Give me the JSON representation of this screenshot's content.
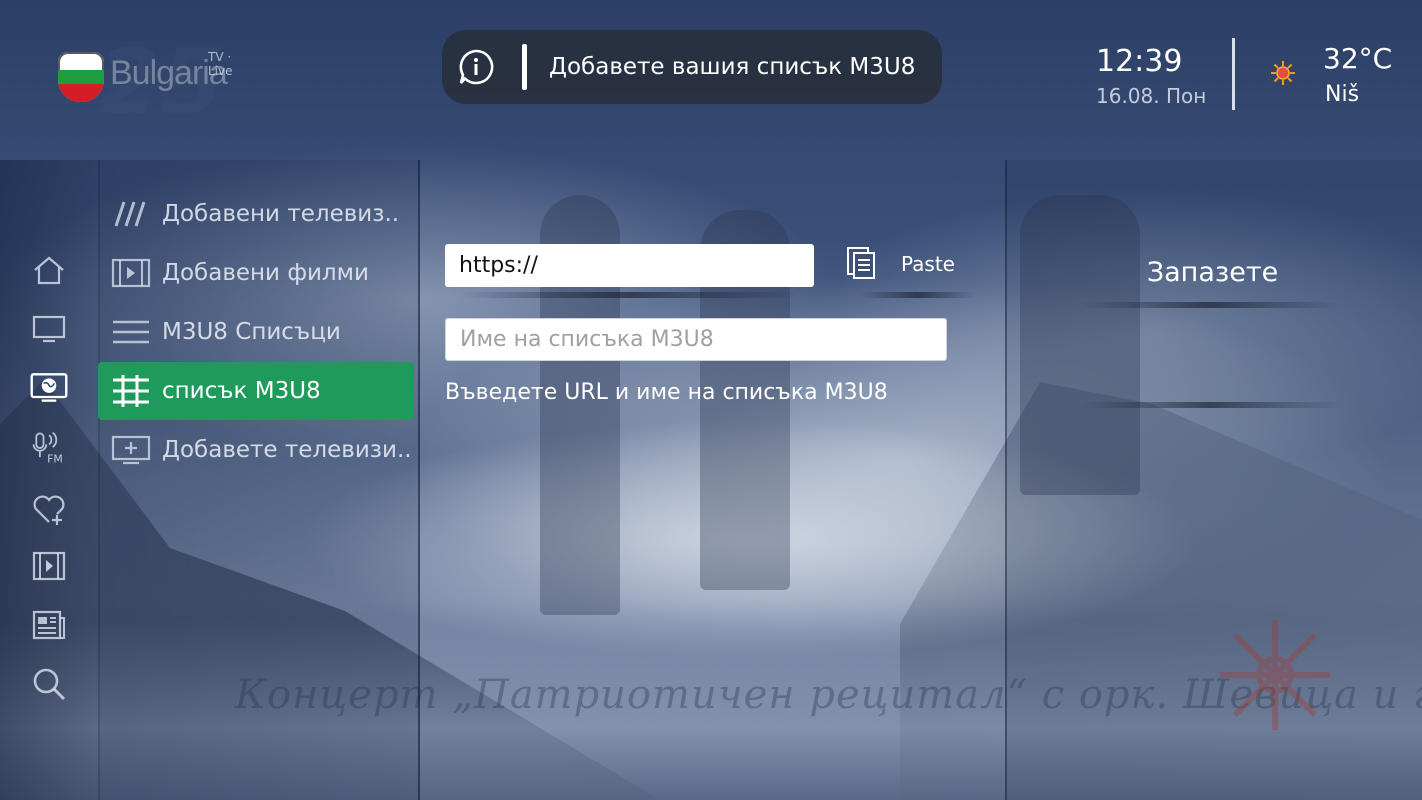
{
  "header": {
    "logo": {
      "brand": "Bulgaria",
      "superscript": "TV · Live"
    },
    "message": {
      "icon": "info-chat-icon",
      "text": "Добавете вашия списък M3U8"
    },
    "clock": {
      "time": "12:39",
      "date": "16.08. Пон"
    },
    "weather": {
      "icon": "sun-icon",
      "temperature": "32°C",
      "city": "Niš"
    }
  },
  "rail": {
    "items": [
      {
        "name": "home-icon"
      },
      {
        "name": "tv-icon"
      },
      {
        "name": "globe-tv-icon"
      },
      {
        "name": "radio-fm-icon",
        "label": "FM"
      },
      {
        "name": "favorites-add-icon"
      },
      {
        "name": "movies-icon"
      },
      {
        "name": "news-icon"
      },
      {
        "name": "search-icon"
      }
    ]
  },
  "menu": {
    "items": [
      {
        "icon": "slashes-icon",
        "label": "Добавени телевиз.."
      },
      {
        "icon": "film-icon",
        "label": "Добавени филми"
      },
      {
        "icon": "list-lines-icon",
        "label": "M3U8 Списъци"
      },
      {
        "icon": "list-add-icon",
        "label": "списък M3U8",
        "active": true
      },
      {
        "icon": "tv-add-icon",
        "label": "Добавете телевизи.."
      }
    ]
  },
  "form": {
    "url_value": "https://",
    "name_placeholder": "Име на списъка M3U8",
    "paste_label": "Paste",
    "hint": "Въведете URL и име на списъка M3U8"
  },
  "actions": {
    "save_label": "Запазете"
  },
  "background": {
    "watermark": "Концерт „Патриотичен рецитал“ с орк. Шевица и гост"
  },
  "colors": {
    "accent_green": "#1e9b5a",
    "message_bar": "#282f3e",
    "background_blue": "#3b5079"
  }
}
